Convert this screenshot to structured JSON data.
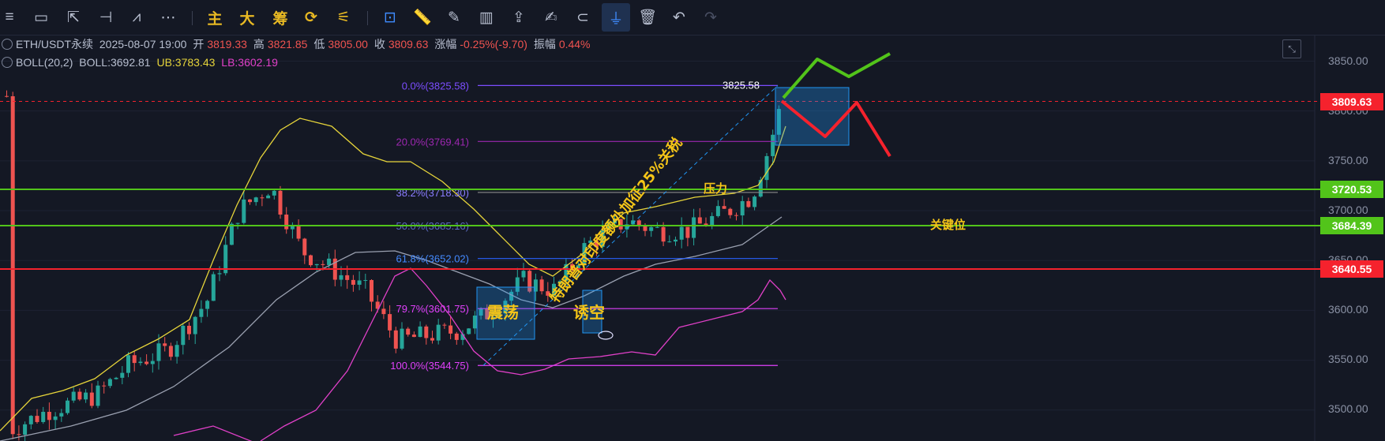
{
  "toolbar": {
    "menu_icon": "≡",
    "rect_icon": "▭",
    "cursor_icon": "⇱",
    "hline_icon": "⊣",
    "fib_icon": "⩘",
    "more_icon": "⋯",
    "main_label": "主",
    "big_label": "大",
    "chips_label": "筹",
    "refresh_icon": "⟳",
    "tools_icon": "⚟",
    "layout_icon": "⊡",
    "ruler_icon": "📏",
    "pen_icon": "✎",
    "indicator_icon": "▥",
    "order_icon": "⇪",
    "note_icon": "✍",
    "magnet_icon": "⊂",
    "filter_icon": "⏚",
    "trash_icon": "🗑",
    "undo_icon": "↶",
    "redo_icon": "↷"
  },
  "symbol": {
    "name": "ETH/USDT永续",
    "datetime": "2025-08-07 19:00",
    "open_label": "开",
    "open": "3819.33",
    "high_label": "高",
    "high": "3821.85",
    "low_label": "低",
    "low": "3805.00",
    "close_label": "收",
    "close": "3809.63",
    "change_label": "涨幅",
    "change": "-0.25%(-9.70)",
    "amp_label": "振幅",
    "amp": "0.44%"
  },
  "boll": {
    "name": "BOLL(20,2)",
    "mid": "BOLL:3692.81",
    "ub": "UB:3783.43",
    "lb": "LB:3602.19"
  },
  "colors": {
    "bg": "#141824",
    "up": "#26a69a",
    "down": "#ef5350",
    "mid": "#e6d43a",
    "ub": "#9aa0b0",
    "lb": "#e040c8",
    "green": "#52c41a",
    "red": "#f5222d"
  },
  "price_axis": [
    "3850.00",
    "3800.00",
    "3750.00",
    "3700.00",
    "3650.00",
    "3600.00",
    "3550.00",
    "3500.00"
  ],
  "tags": {
    "current": "3809.63",
    "resist": "3720.53",
    "key": "3684.39",
    "support": "3640.55"
  },
  "fib": {
    "f0": "0.0%(3825.58)",
    "f20": "20.0%(3769.41)",
    "f382": "38.2%(3718.30)",
    "f50": "50.0%(3685.16)",
    "f618": "61.8%(3652.02)",
    "f797": "79.7%(3601.75)",
    "f100": "100.0%(3544.75)",
    "top_price": "3825.58"
  },
  "annotations": {
    "zhendang": "震荡",
    "youkong": "诱空",
    "yali": "压力",
    "guanjian": "关键位",
    "news": "特朗普对印度额外加征25%关税"
  }
}
